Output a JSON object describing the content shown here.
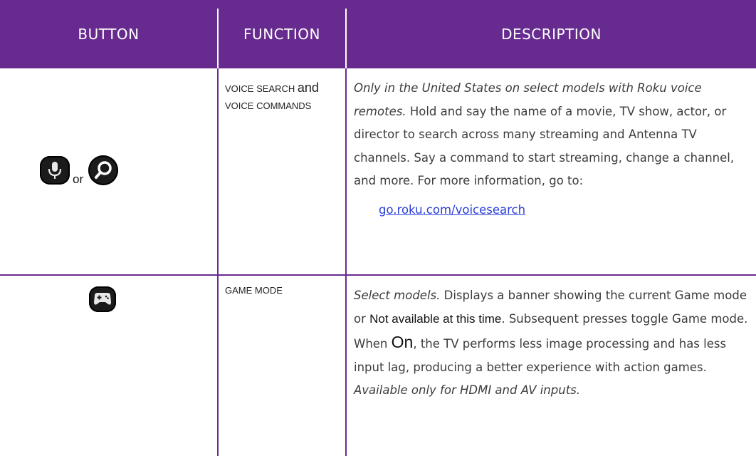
{
  "header": {
    "col_button": "BUTTON",
    "col_function": "FUNCTION",
    "col_description": "DESCRIPTION"
  },
  "rows": [
    {
      "button_icons": [
        "microphone-icon",
        "search-icon"
      ],
      "or_label": "or",
      "function_part1": "VOICE SEARCH ",
      "function_part2": "and",
      "function_line2": "VOICE COMMANDS",
      "desc_italic": "Only in the United States on select models with Roku voice remotes.",
      "desc_text": " Hold and say the name of a movie, TV show, actor, or director to search across many streaming and Antenna TV channels. Say a command to start streaming, change a channel, and more. For more information, go to:",
      "link": "go.roku.com/voicesearch"
    },
    {
      "button_icons": [
        "gamepad-icon"
      ],
      "function": "GAME MODE",
      "desc_italic1": "Select models.",
      "desc_text1": " Displays a banner showing the current Game mode or ",
      "desc_emph1": "Not available at this time",
      "desc_text2": ". Subsequent presses toggle Game mode. When ",
      "desc_emph2": "On",
      "desc_text3": ", the TV performs less image processing and has less input lag, producing a better experience with action games. ",
      "desc_italic2": "Available only for HDMI and AV inputs."
    }
  ],
  "colors": {
    "header_bg": "#672b8f",
    "link": "#2a3fd6"
  }
}
